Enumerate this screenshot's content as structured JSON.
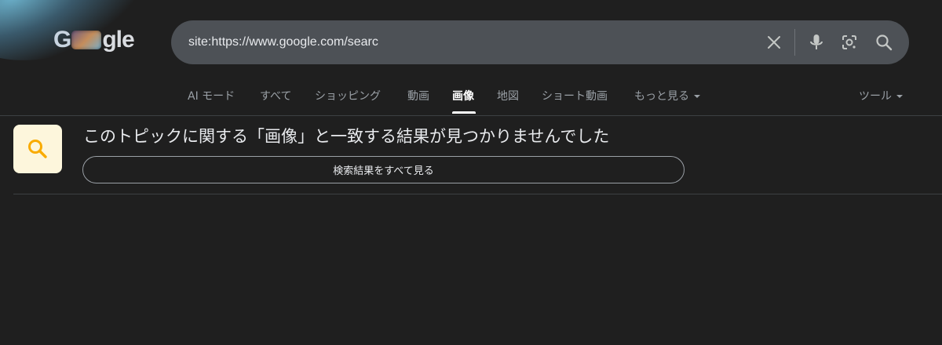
{
  "logo": {
    "text_start": "G",
    "text_end": "gle"
  },
  "search": {
    "value": "site:https://www.google.com/searc"
  },
  "icons": {
    "clear": "close-icon",
    "voice": "mic-icon",
    "lens": "camera-lens-icon",
    "search": "search-icon",
    "result": "search-icon"
  },
  "tabs": [
    {
      "label": "AI モード"
    },
    {
      "label": "すべて"
    },
    {
      "label": "ショッピング"
    },
    {
      "label": "動画"
    },
    {
      "label": "画像",
      "active": true
    },
    {
      "label": "地図"
    },
    {
      "label": "ショート動画"
    },
    {
      "label": "もっと見る"
    }
  ],
  "tools_label": "ツール",
  "result": {
    "message": "このトピックに関する「画像」と一致する結果が見つかりませんでした",
    "see_all_label": "検索結果をすべて見る"
  },
  "colors": {
    "background": "#1f1f1f",
    "search_box": "#4d5156",
    "accent_yellow": "#f9ab00",
    "result_icon_bg": "#fdf6dc"
  }
}
